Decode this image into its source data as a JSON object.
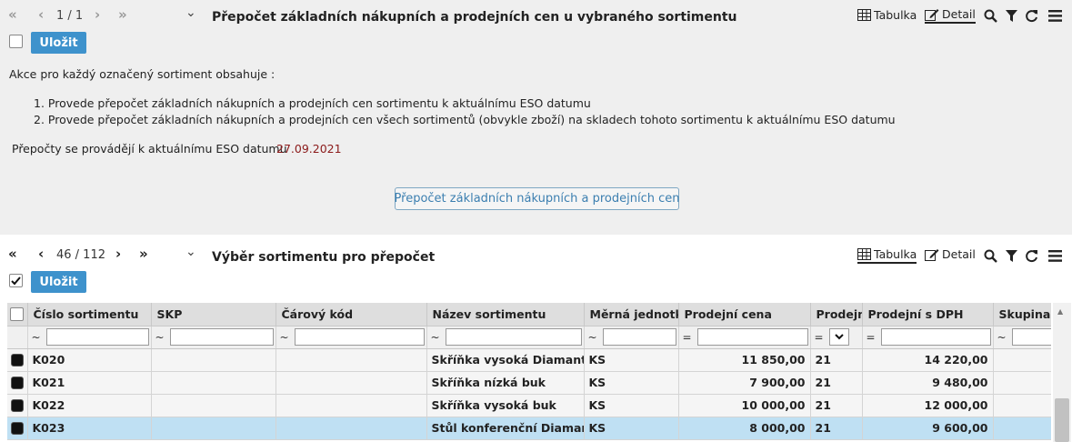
{
  "top_panel": {
    "pager": {
      "first": "«",
      "prev": "‹",
      "position": "1 / 1",
      "next": "›",
      "last": "»"
    },
    "expand": "⌄",
    "title": "Přepočet základních nákupních a prodejních cen u vybraného sortimentu",
    "views": {
      "table": "Tabulka",
      "detail": "Detail"
    },
    "save_label": "Uložit",
    "intro": "Akce pro každý označený sortiment obsahuje :",
    "steps": [
      "1. Provede přepočet základních nákupních a prodejních cen sortimentu k aktuálnímu ESO datumu",
      "2. Provede přepočet základních nákupních a prodejních cen všech sortimentů (obvykle zboží) na skladech tohoto sortimentu k aktuálnímu ESO datumu"
    ],
    "date_label": "Přepočty se provádějí k aktuálnímu ESO datumu",
    "date_value": "27.09.2021",
    "recalc_button": "Přepočet základních nákupních a prodejních cen"
  },
  "bottom_panel": {
    "pager": {
      "first": "«",
      "prev": "‹",
      "position": "46 / 112",
      "next": "›",
      "last": "»"
    },
    "expand": "⌄",
    "title": "Výběr sortimentu pro přepočet",
    "views": {
      "table": "Tabulka",
      "detail": "Detail"
    },
    "save_label": "Uložit",
    "columns": [
      "Číslo sortimentu",
      "SKP",
      "Čárový kód",
      "Název sortimentu",
      "Měrná jednotka",
      "Prodejní cena",
      "Prodejní",
      "Prodejní s DPH",
      "Skupina P"
    ],
    "filter_ops": [
      "~",
      "~",
      "~",
      "~",
      "~",
      "=",
      "=",
      "=",
      "~"
    ],
    "rows": [
      {
        "code": "K020",
        "skp": "",
        "barcode": "",
        "name": "Skříňka vysoká Diamant",
        "unit": "KS",
        "price": "11 850,00",
        "vat": "21",
        "price_vat": "14 220,00",
        "group": ""
      },
      {
        "code": "K021",
        "skp": "",
        "barcode": "",
        "name": "Skříňka nízká buk",
        "unit": "KS",
        "price": "7 900,00",
        "vat": "21",
        "price_vat": "9 480,00",
        "group": ""
      },
      {
        "code": "K022",
        "skp": "",
        "barcode": "",
        "name": "Skříňka vysoká buk",
        "unit": "KS",
        "price": "10 000,00",
        "vat": "21",
        "price_vat": "12 000,00",
        "group": ""
      },
      {
        "code": "K023",
        "skp": "",
        "barcode": "",
        "name": "Stůl konferenční Diamant",
        "unit": "KS",
        "price": "8 000,00",
        "vat": "21",
        "price_vat": "9 600,00",
        "group": ""
      }
    ],
    "selected_row_index": 3
  },
  "colors": {
    "accent": "#3e92cc",
    "selected_row": "#bfe0f3",
    "date": "#8b1a1a"
  }
}
